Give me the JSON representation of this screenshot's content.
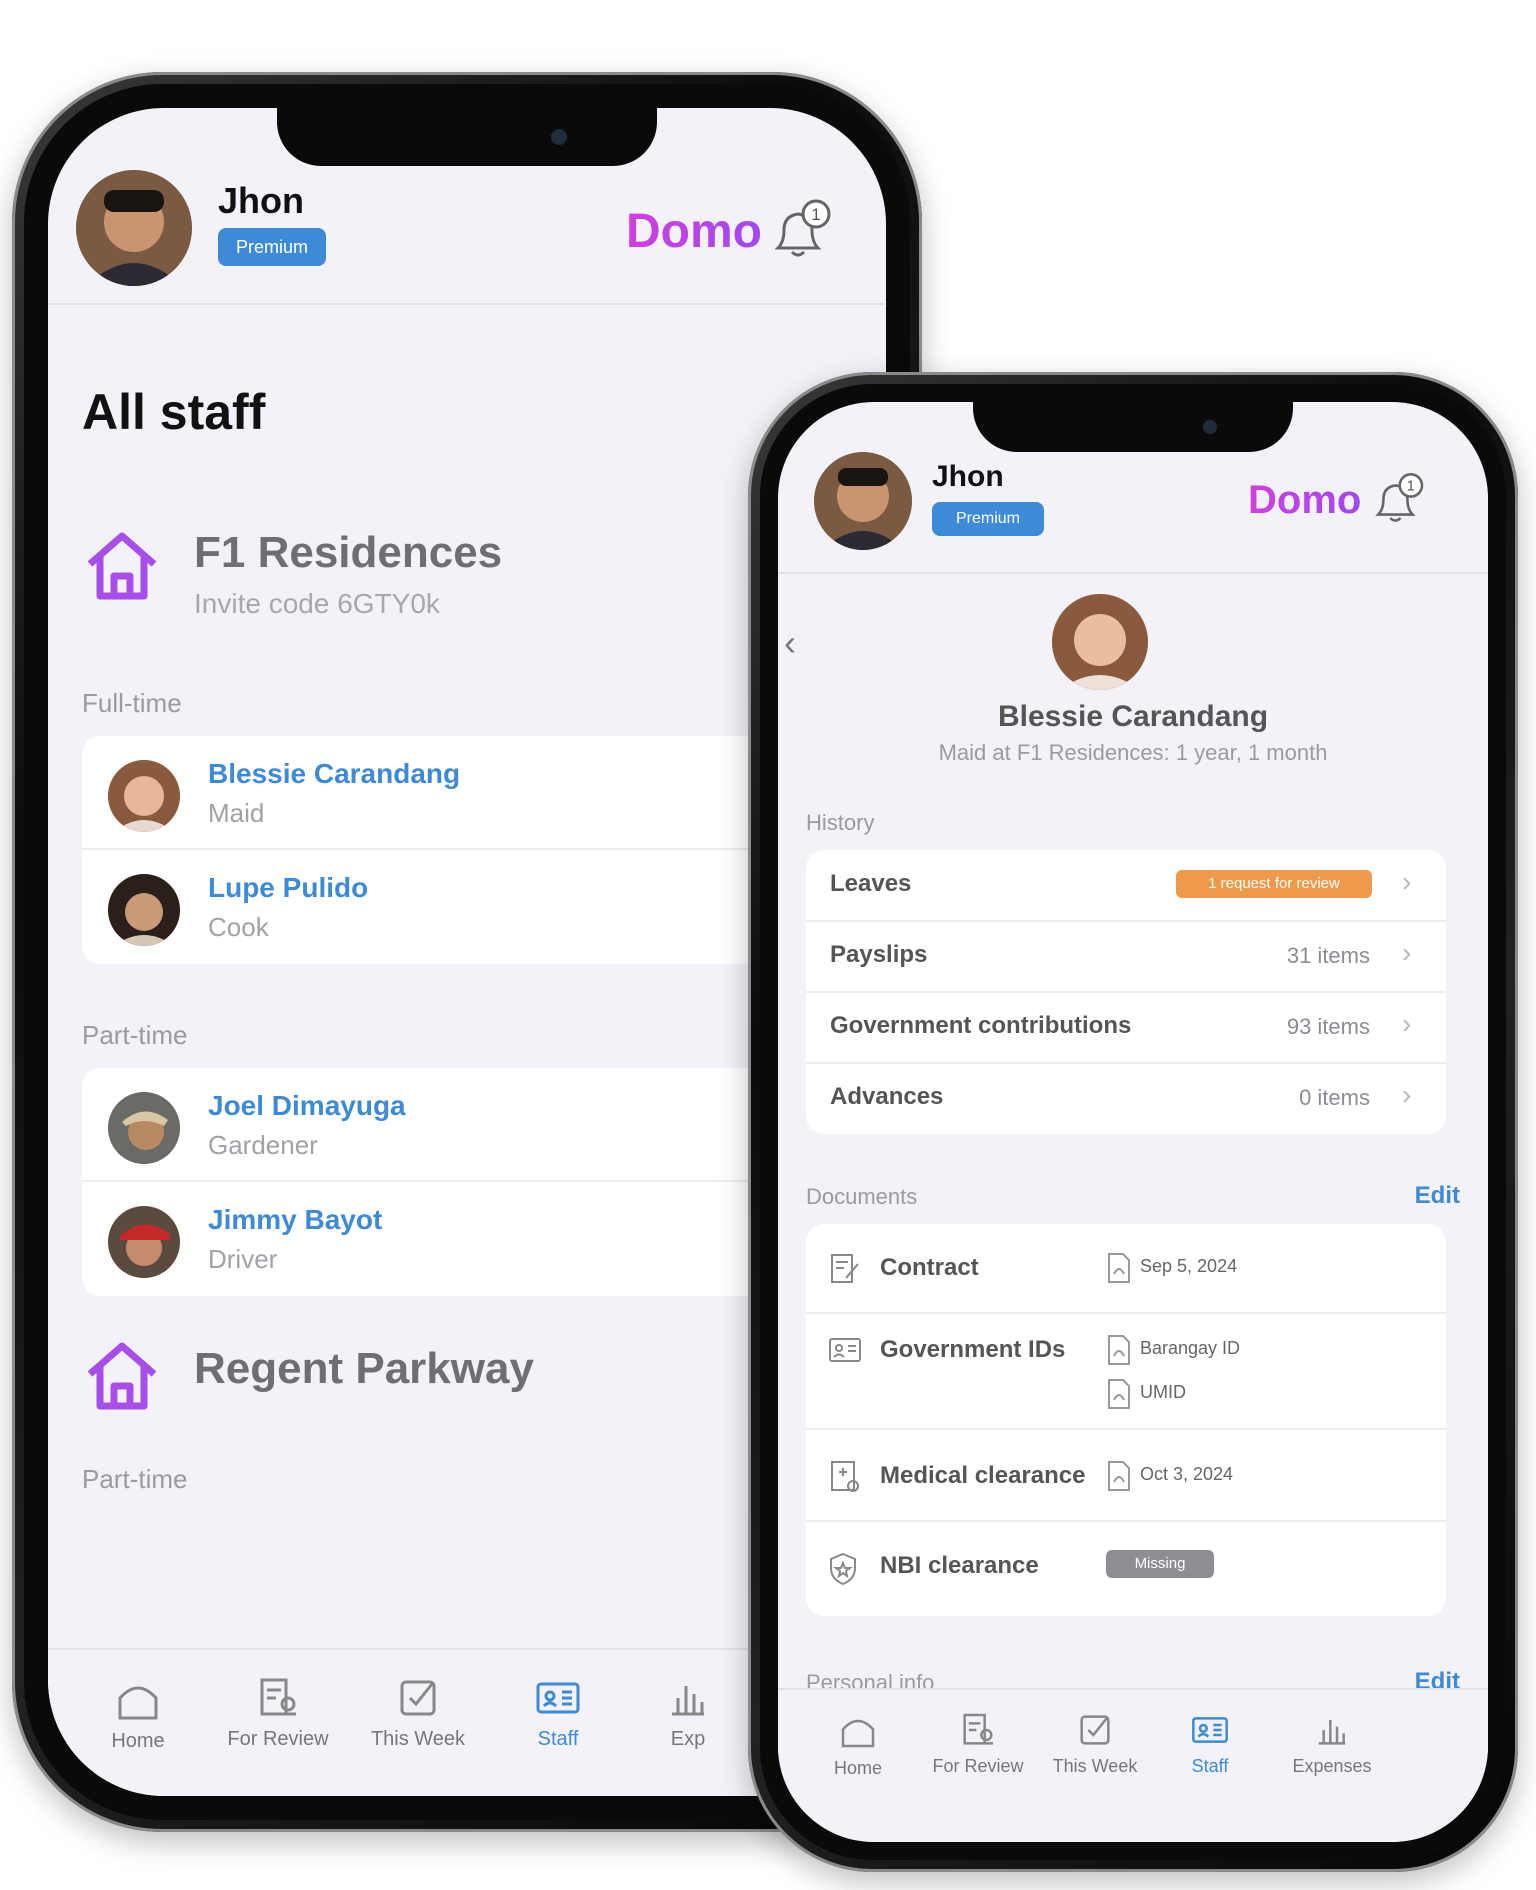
{
  "left_phone": {
    "header": {
      "user_name": "Jhon",
      "badge": "Premium",
      "brand": "Domo",
      "notification_count": "1"
    },
    "page_title": "All staff",
    "properties": [
      {
        "name": "F1 Residences",
        "invite_code": "Invite code 6GTY0k",
        "groups": [
          {
            "label": "Full-time",
            "staff": [
              {
                "name": "Blessie Carandang",
                "role": "Maid"
              },
              {
                "name": "Lupe Pulido",
                "role": "Cook"
              }
            ]
          },
          {
            "label": "Part-time",
            "staff": [
              {
                "name": "Joel Dimayuga",
                "role": "Gardener"
              },
              {
                "name": "Jimmy Bayot",
                "role": "Driver"
              }
            ]
          }
        ]
      },
      {
        "name": "Regent Parkway",
        "next_group_label": "Part-time"
      }
    ],
    "tabs": [
      {
        "label": "Home",
        "icon": "home-icon"
      },
      {
        "label": "For Review",
        "icon": "review-icon"
      },
      {
        "label": "This Week",
        "icon": "check-icon"
      },
      {
        "label": "Staff",
        "icon": "staff-card-icon",
        "active": true
      },
      {
        "label": "Exp",
        "icon": "expenses-icon"
      }
    ]
  },
  "right_phone": {
    "header": {
      "user_name": "Jhon",
      "badge": "Premium",
      "brand": "Domo",
      "notification_count": "1"
    },
    "profile": {
      "name": "Blessie Carandang",
      "subtitle": "Maid at F1 Residences: 1 year, 1 month"
    },
    "history": {
      "label": "History",
      "items": [
        {
          "label": "Leaves",
          "value": "1 request for review",
          "badge": true
        },
        {
          "label": "Payslips",
          "value": "31 items"
        },
        {
          "label": "Government contributions",
          "value": "93 items"
        },
        {
          "label": "Advances",
          "value": "0 items"
        }
      ]
    },
    "documents": {
      "label": "Documents",
      "edit": "Edit",
      "items": [
        {
          "label": "Contract",
          "icon": "contract-icon",
          "files": [
            "Sep 5, 2024"
          ]
        },
        {
          "label": "Government IDs",
          "icon": "id-card-icon",
          "files": [
            "Barangay ID",
            "UMID"
          ]
        },
        {
          "label": "Medical clearance",
          "icon": "medical-icon",
          "files": [
            "Oct 3, 2024"
          ]
        },
        {
          "label": "NBI clearance",
          "icon": "shield-icon",
          "status": "Missing"
        }
      ]
    },
    "personal_info": {
      "label": "Personal info",
      "edit": "Edit"
    },
    "tabs": [
      {
        "label": "Home",
        "icon": "home-icon"
      },
      {
        "label": "For Review",
        "icon": "review-icon"
      },
      {
        "label": "This Week",
        "icon": "check-icon"
      },
      {
        "label": "Staff",
        "icon": "staff-card-icon",
        "active": true
      },
      {
        "label": "Expenses",
        "icon": "expenses-icon"
      }
    ]
  },
  "colors": {
    "accent_blue": "#3d8ad6",
    "brand_purple": "#c341e6",
    "orange_badge": "#ef9a4a",
    "missing_gray": "#8e8e93"
  }
}
